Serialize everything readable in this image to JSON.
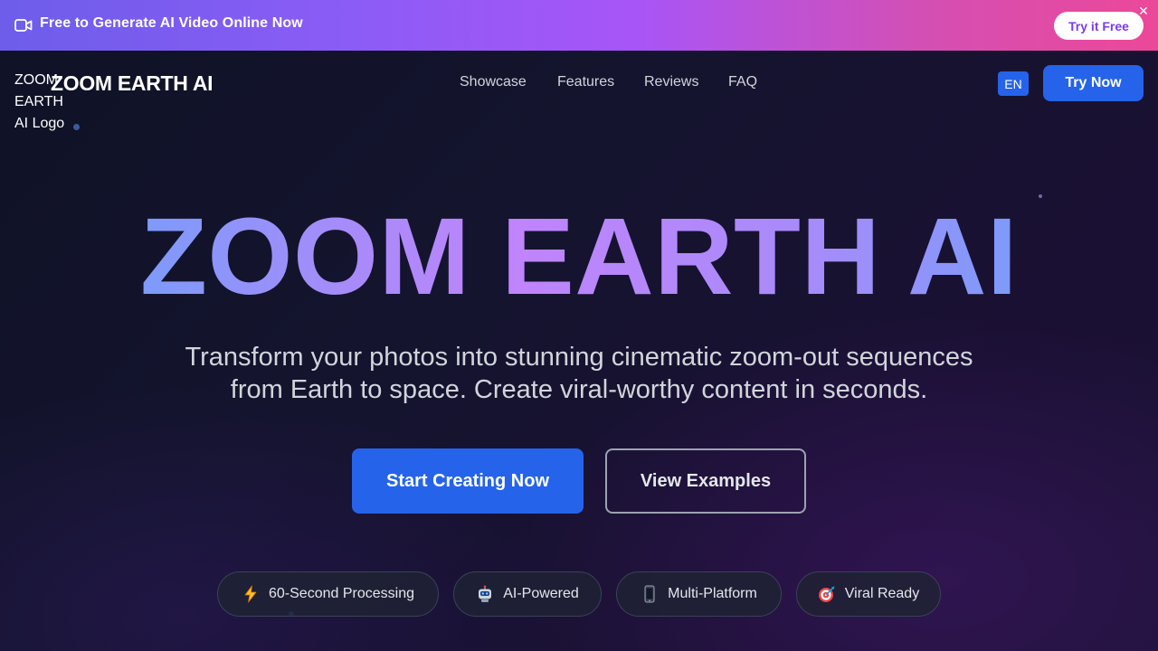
{
  "banner": {
    "text": "Free to Generate AI Video Online Now",
    "cta": "Try it Free",
    "close": "✕",
    "icon": "video-camera-icon"
  },
  "nav": {
    "logo_alt": "ZOOM EARTH AI Logo",
    "brand": "ZOOM EARTH AI",
    "links": [
      "Showcase",
      "Features",
      "Reviews",
      "FAQ"
    ],
    "lang": "EN",
    "cta": "Try Now"
  },
  "hero": {
    "title": "ZOOM EARTH AI",
    "subtitle_line1": "Transform your photos into stunning cinematic zoom-out sequences",
    "subtitle_line2": "from Earth to space. Create viral-worthy content in seconds.",
    "primary_cta": "Start Creating Now",
    "secondary_cta": "View Examples"
  },
  "features": [
    {
      "icon": "lightning-icon",
      "label": "60-Second Processing"
    },
    {
      "icon": "robot-icon",
      "label": "AI-Powered"
    },
    {
      "icon": "mobile-phone-icon",
      "label": "Multi-Platform"
    },
    {
      "icon": "target-icon",
      "label": "Viral Ready"
    }
  ],
  "colors": {
    "accent": "#2563eb",
    "banner_start": "#6d5dea",
    "banner_end": "#ec4899",
    "title_blue": "#60a5fa",
    "title_purple": "#c084fc",
    "background": "#101226"
  }
}
